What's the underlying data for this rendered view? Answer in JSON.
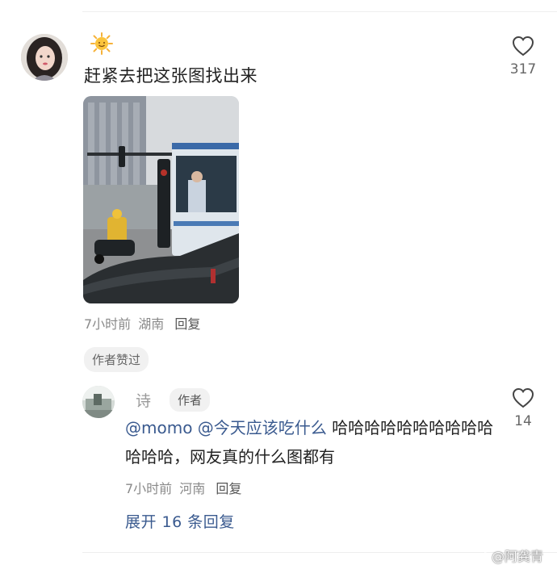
{
  "main_comment": {
    "text": "赶紧去把这张图找出来",
    "like_count": "317",
    "meta": {
      "time": "7小时前",
      "location": "湖南",
      "reply_label": "回复"
    },
    "liked_by_author": "作者赞过",
    "icons": {
      "emoji": "sun-emoji",
      "like": "heart-outline-icon"
    }
  },
  "reply": {
    "author": "诗",
    "author_tag": "作者",
    "mention1": "@momo",
    "mention2": "@今天应该吃什么",
    "text": " 哈哈哈哈哈哈哈哈哈哈哈哈哈，网友真的什么图都有",
    "like_count": "14",
    "meta": {
      "time": "7小时前",
      "location": "河南",
      "reply_label": "回复"
    }
  },
  "expand_replies": "展开 16 条回复",
  "watermark": "@阿龚青",
  "colors": {
    "link": "#3a5a8f",
    "meta_gray": "#8a8a8a",
    "badge_bg": "#f1f1f1"
  }
}
